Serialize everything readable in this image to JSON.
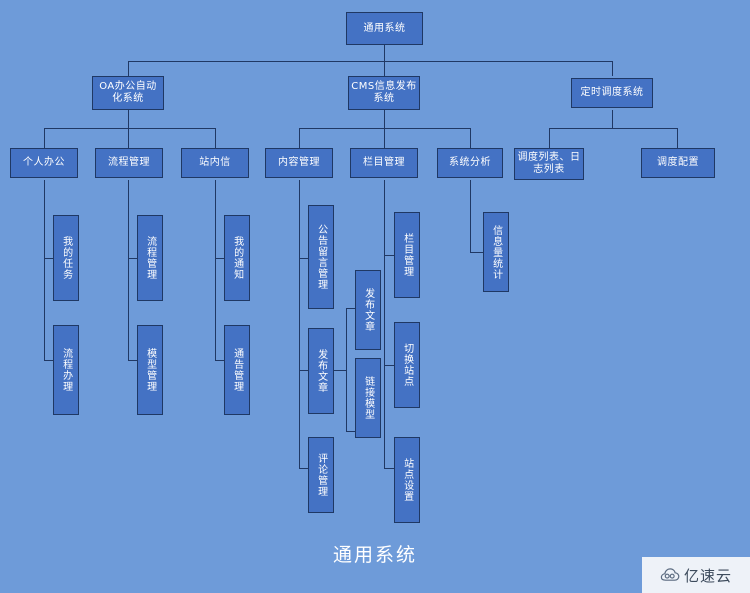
{
  "diagram": {
    "title": "通用系统",
    "caption": "通用系统",
    "colors": {
      "background": "#6e9bd9",
      "node_fill": "#4472c4",
      "node_border": "#1f3864",
      "node_text": "#ffffff",
      "line": "#203864",
      "caption_text": "#ffffff"
    },
    "nodes": {
      "root": "通用系统",
      "oa": "OA办公自动化系统",
      "cms": "CMS信息发布系统",
      "sched": "定时调度系统",
      "oa_personal": "个人办公",
      "oa_process": "流程管理",
      "oa_msg": "站内信",
      "cms_content": "内容管理",
      "cms_column": "栏目管理",
      "cms_analysis": "系统分析",
      "sched_list": "调度列表、日志列表",
      "sched_config": "调度配置",
      "personal_task": "我的任务",
      "personal_handle": "流程办理",
      "process_manage": "流程管理",
      "process_model": "模型管理",
      "msg_notice": "我的通知",
      "msg_announce": "通告管理",
      "content_board": "公告留言管理",
      "content_publish": "发布文章",
      "content_comment": "评论管理",
      "publish_article": "发布文章",
      "publish_link": "链接模型",
      "column_manage": "栏目管理",
      "column_switch": "切换站点",
      "column_setting": "站点设置",
      "analysis_stat": "信息量统计"
    }
  },
  "watermark": {
    "icon": "cloud-icon",
    "text": "亿速云"
  }
}
